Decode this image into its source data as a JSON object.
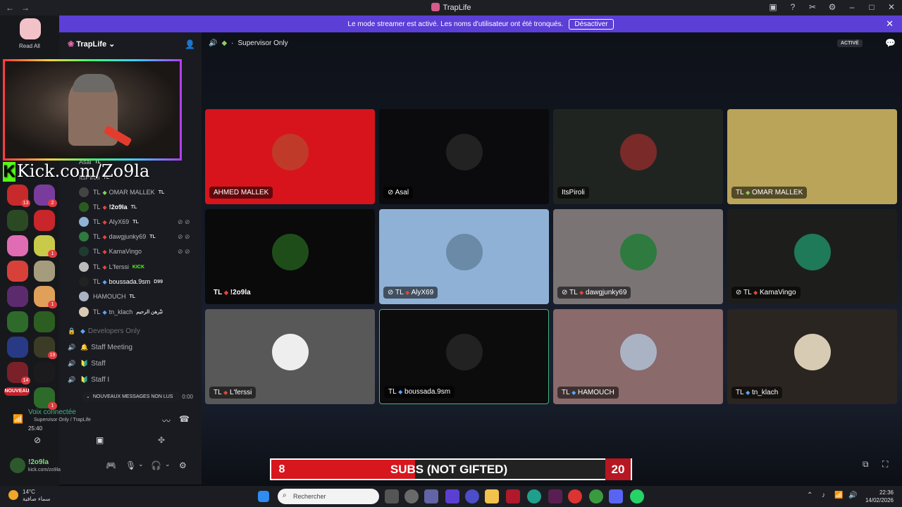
{
  "titlebar": {
    "title": "TrapLife",
    "back": "←",
    "forward": "→"
  },
  "banner": {
    "text": "Le mode streamer est activé. Les noms d'utilisateur ont été tronqués.",
    "button": "Désactiver",
    "close": "✕"
  },
  "rail": {
    "read_all": "Read All",
    "new_label": "NOUVEAU",
    "badges": [
      "13",
      "2",
      "1",
      "1",
      "19",
      "14",
      "1"
    ]
  },
  "server": {
    "name": "TrapLife",
    "channel": "Supervisor Only",
    "active": "ACTIVÉ"
  },
  "members": [
    {
      "name": "Asal",
      "prefix": "",
      "tag": "TL"
    },
    {
      "name": "ItsPiroli",
      "prefix": "",
      "tag": "TL"
    },
    {
      "name": "OMAR MALLEK",
      "prefix": "TL",
      "tag": "TL"
    },
    {
      "name": "!2o9la",
      "prefix": "TL",
      "tag": "TL"
    },
    {
      "name": "AlyX69",
      "prefix": "TL",
      "tag": "TL"
    },
    {
      "name": "dawgjunky69",
      "prefix": "TL",
      "tag": "TL"
    },
    {
      "name": "KamaVingo",
      "prefix": "TL",
      "tag": ""
    },
    {
      "name": "L'ferssi",
      "prefix": "TL",
      "tag": "KICK"
    },
    {
      "name": "boussada.9sm",
      "prefix": "TL",
      "tag": "D99"
    },
    {
      "name": "HAMOUCH",
      "prefix": "TL",
      "tag": "TL"
    },
    {
      "name": "tn_klach",
      "prefix": "TL",
      "tag": "تبّرهن الرحيم"
    }
  ],
  "channels": [
    {
      "name": "Developers Only",
      "emo": "🔒"
    },
    {
      "name": "Staff Meeting",
      "emo": "🔔"
    },
    {
      "name": "Staff",
      "emo": "🔰"
    },
    {
      "name": "Staff I",
      "emo": "🔰"
    }
  ],
  "unread": "NOUVEAUX MESSAGES NON LUS",
  "unread_time": "0:00",
  "voice": {
    "status": "Voix connectée",
    "location": "Supervisor Only / TrapLife",
    "time": "25:40"
  },
  "user": {
    "name": "!2o9la",
    "status": "kick.com/zo9la"
  },
  "kick_overlay": {
    "k": "K",
    "text": "Kick.com/Zo9la"
  },
  "tiles": [
    {
      "name": "AHMED MALLEK",
      "prefix": "",
      "bg": "#d7141b",
      "avatar": "#c03a2a"
    },
    {
      "name": "Asal",
      "prefix": "",
      "bg": "#0b0b0d",
      "avatar": "#222"
    },
    {
      "name": "ItsPiroli",
      "prefix": "",
      "bg": "#202421",
      "avatar": "#7a2a28"
    },
    {
      "name": "OMAR MALLEK",
      "prefix": "TL",
      "bg": "#b9a45a",
      "avatar": "#b9a45a"
    },
    {
      "name": "!2o9la",
      "prefix": "TL",
      "bg": "#0a0a0a",
      "avatar": "#1e4d1a"
    },
    {
      "name": "AlyX69",
      "prefix": "TL",
      "bg": "#8fb1d6",
      "avatar": "#6a8aa8"
    },
    {
      "name": "dawgjunky69",
      "prefix": "TL",
      "bg": "#7a7475",
      "avatar": "#2e7a3f"
    },
    {
      "name": "KamaVingo",
      "prefix": "TL",
      "bg": "#1d1e1b",
      "avatar": "#1f7a5a"
    },
    {
      "name": "L'ferssi",
      "prefix": "TL",
      "bg": "#585858",
      "avatar": "#eeeeee"
    },
    {
      "name": "boussada.9sm",
      "prefix": "TL",
      "bg": "#0c0c0d",
      "avatar": "#222"
    },
    {
      "name": "HAMOUCH",
      "prefix": "TL",
      "bg": "#8a6a6b",
      "avatar": "#a9b3c4"
    },
    {
      "name": "tn_klach",
      "prefix": "TL",
      "bg": "#2a2520",
      "avatar": "#d8cbb4"
    }
  ],
  "subs": {
    "left": "8",
    "label": "SUBS (NOT GIFTED)",
    "right": "20"
  },
  "taskbar": {
    "temp": "14°C",
    "weather": "سماء صافية",
    "search": "Rechercher",
    "time": "22:36",
    "date": "14/02/2026"
  },
  "colors": {
    "accent": "#5b3fd6",
    "online": "#43b581",
    "brand_kick": "#53fc18"
  }
}
